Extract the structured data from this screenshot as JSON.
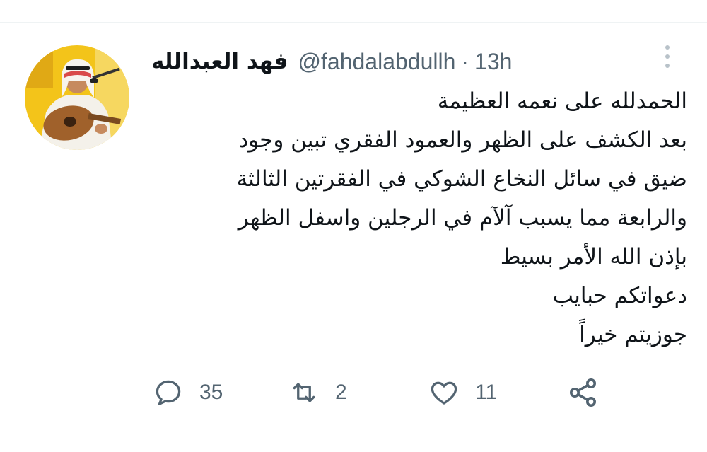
{
  "tweet": {
    "display_name": "فهد العبدالله",
    "handle": "@fahdalabdullh",
    "separator": "·",
    "time": "13h",
    "body_lines": [
      "الحمدلله على نعمه العظيمة",
      "بعد الكشف على الظهر والعمود الفقري تبين وجود",
      "ضيق في سائل النخاع الشوكي في الفقرتين الثالثة",
      "والرابعة مما يسبب آلآم في الرجلين واسفل الظهر",
      "بإذن الله الأمر بسيط",
      "دعواتكم حبايب",
      "جوزيتم خيراً"
    ]
  },
  "actions": {
    "replies": "35",
    "retweets": "2",
    "likes": "11"
  },
  "icons": {
    "reply": "reply-icon",
    "retweet": "retweet-icon",
    "like": "heart-icon",
    "share": "share-icon",
    "more": "more-icon"
  },
  "colors": {
    "text_primary": "#0f1419",
    "text_secondary": "#536471",
    "divider": "#eff3f4",
    "avatar_bg": "#f3c41a"
  }
}
